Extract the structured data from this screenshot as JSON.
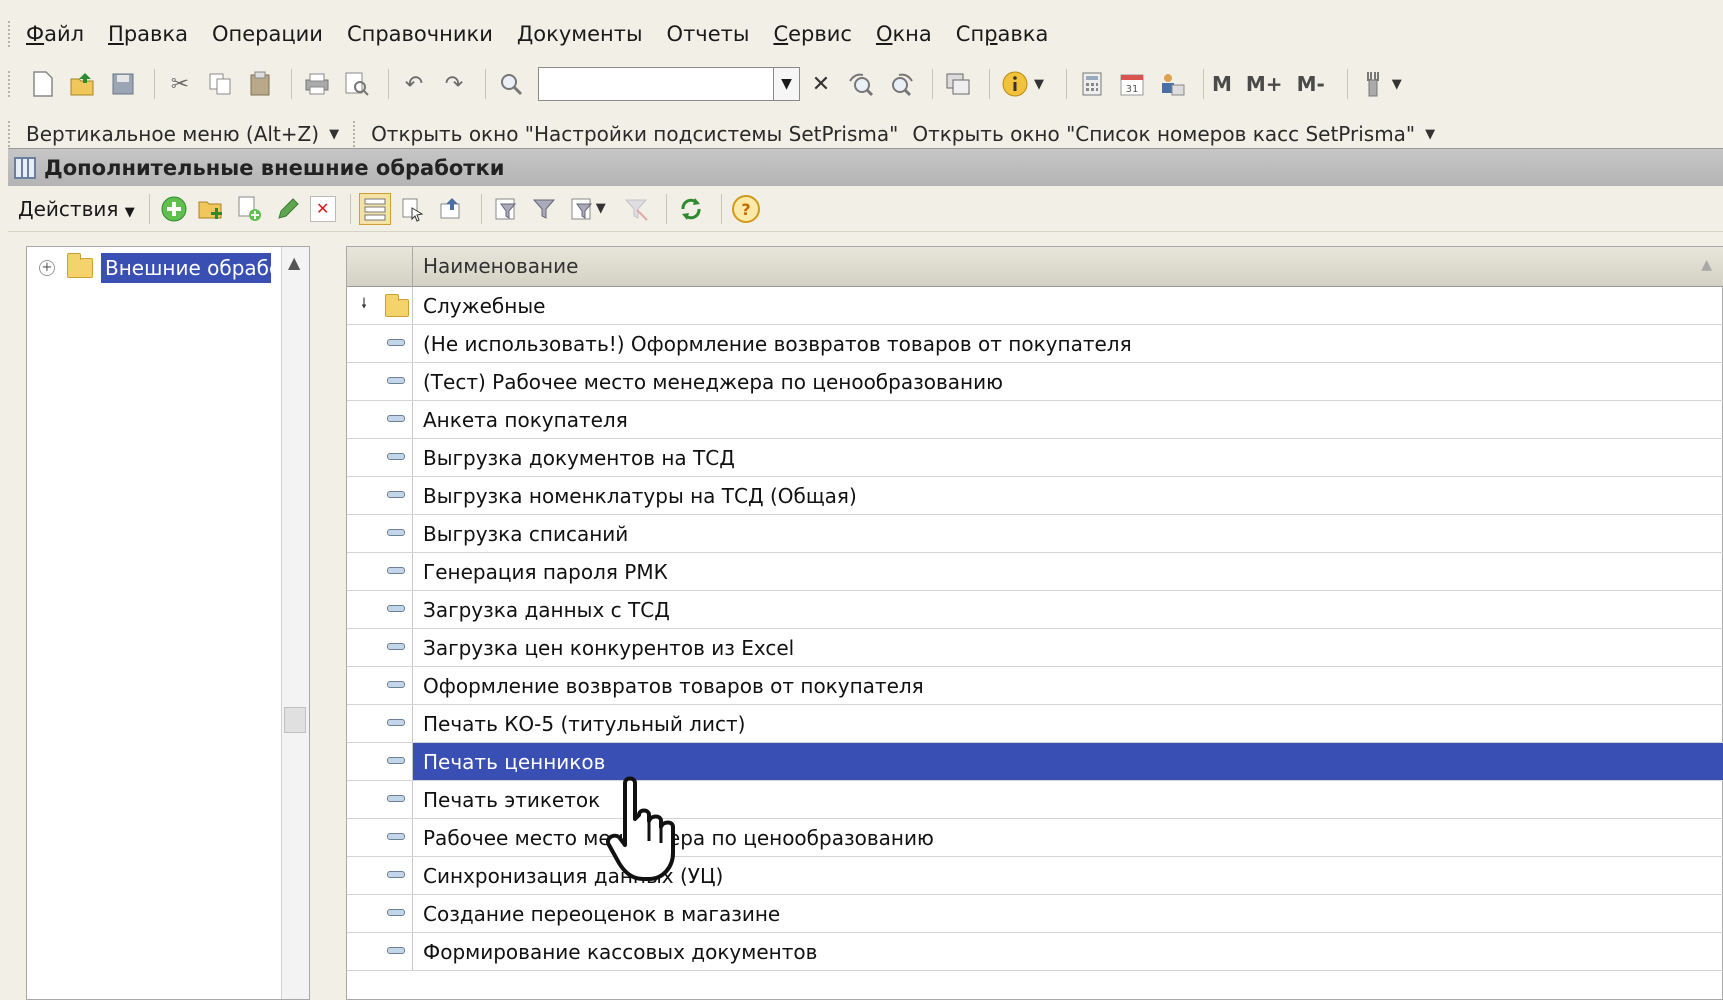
{
  "menubar": {
    "items": [
      {
        "pre": "",
        "u": "Ф",
        "post": "айл"
      },
      {
        "pre": "",
        "u": "П",
        "post": "равка"
      },
      {
        "pre": "Операции",
        "u": "",
        "post": ""
      },
      {
        "pre": "Справочники",
        "u": "",
        "post": ""
      },
      {
        "pre": "Документы",
        "u": "",
        "post": ""
      },
      {
        "pre": "Отчеты",
        "u": "",
        "post": ""
      },
      {
        "pre": "",
        "u": "С",
        "post": "ервис"
      },
      {
        "pre": "",
        "u": "О",
        "post": "кна"
      },
      {
        "pre": "Сп",
        "u": "р",
        "post": "авка"
      }
    ]
  },
  "toolbar": {
    "search_value": "",
    "m_label": "M",
    "mplus_label": "M+",
    "mminus_label": "M-"
  },
  "quickbar": {
    "vertical_menu": "Вертикальное меню (Alt+Z)",
    "open_settings": "Открыть окно \"Настройки подсистемы SetPrisma\"",
    "open_cash_list": "Открыть окно \"Список номеров касс SetPrisma\""
  },
  "window": {
    "title": "Дополнительные внешние обработки",
    "actions_label": "Действия"
  },
  "tree": {
    "root_label": "Внешние обработки"
  },
  "list": {
    "column_name": "Наименование",
    "group_row": "Служебные",
    "rows": [
      "(Не использовать!) Оформление возвратов товаров от покупателя",
      "(Тест) Рабочее место менеджера по ценообразованию",
      "Анкета покупателя",
      "Выгрузка документов на ТСД",
      "Выгрузка номенклатуры на ТСД (Общая)",
      "Выгрузка списаний",
      "Генерация пароля РМК",
      "Загрузка данных с ТСД",
      "Загрузка цен конкурентов из Excel",
      "Оформление возвратов товаров от покупателя",
      "Печать КО-5 (титульный лист)",
      "Печать ценников",
      "Печать этикеток",
      "Рабочее место менеджера по ценообразованию",
      "Синхронизация данных (УЦ)",
      "Создание переоценок в магазине",
      "Формирование кассовых документов"
    ],
    "selected_index": 11
  },
  "colors": {
    "selection": "#3a4fb3",
    "background": "#f2f0e6"
  }
}
